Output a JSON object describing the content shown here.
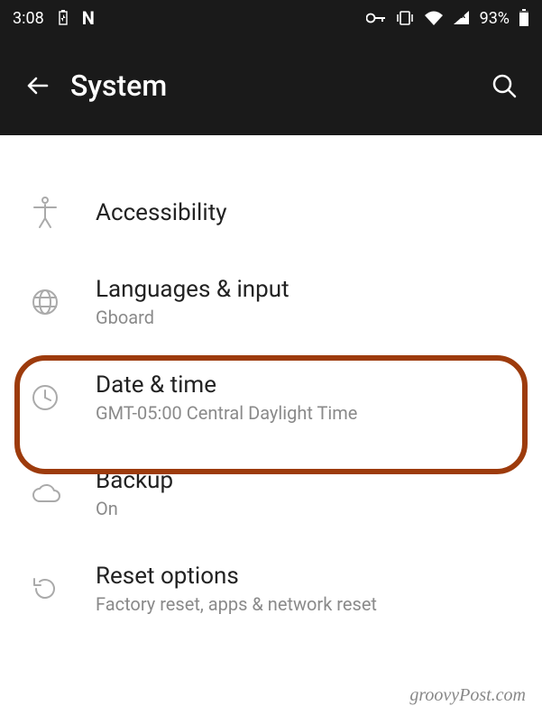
{
  "status": {
    "time": "3:08",
    "battery_percent": "93%"
  },
  "header": {
    "title": "System"
  },
  "items": [
    {
      "title": "Accessibility",
      "subtitle": ""
    },
    {
      "title": "Languages & input",
      "subtitle": "Gboard"
    },
    {
      "title": "Date & time",
      "subtitle": "GMT-05:00 Central Daylight Time"
    },
    {
      "title": "Backup",
      "subtitle": "On"
    },
    {
      "title": "Reset options",
      "subtitle": "Factory reset, apps & network reset"
    }
  ],
  "watermark": "groovyPost.com"
}
